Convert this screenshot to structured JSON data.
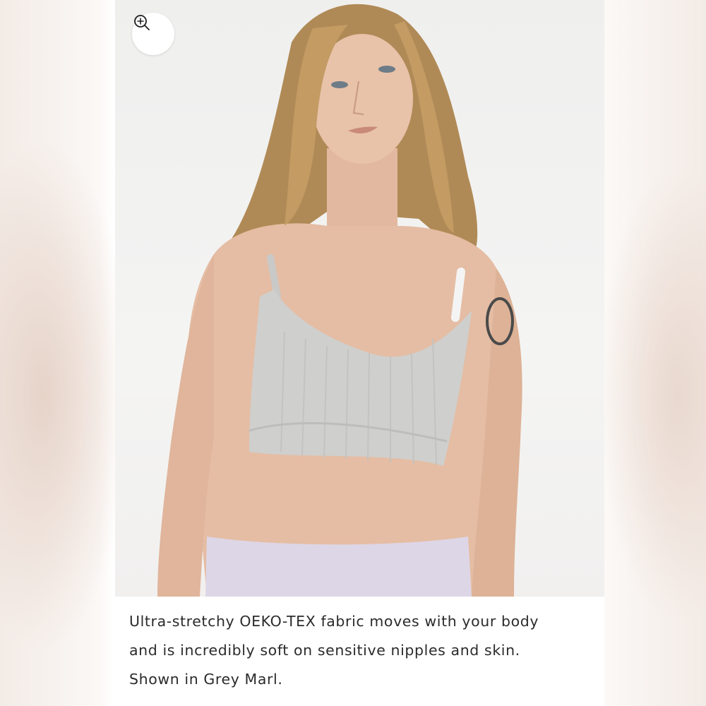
{
  "product_image": {
    "alt_subject": "model-wearing-nursing-bra"
  },
  "zoom_button": {
    "icon": "zoom-in-icon"
  },
  "caption": {
    "line1": "Ultra-stretchy OEKO-TEX fabric moves with your body",
    "line2": "and is incredibly soft on sensitive nipples and skin.",
    "line3": "Shown in Grey Marl."
  },
  "colors": {
    "bra": "#cfcfcd",
    "background": "#f1f1f0",
    "text": "#2b2b2b"
  }
}
